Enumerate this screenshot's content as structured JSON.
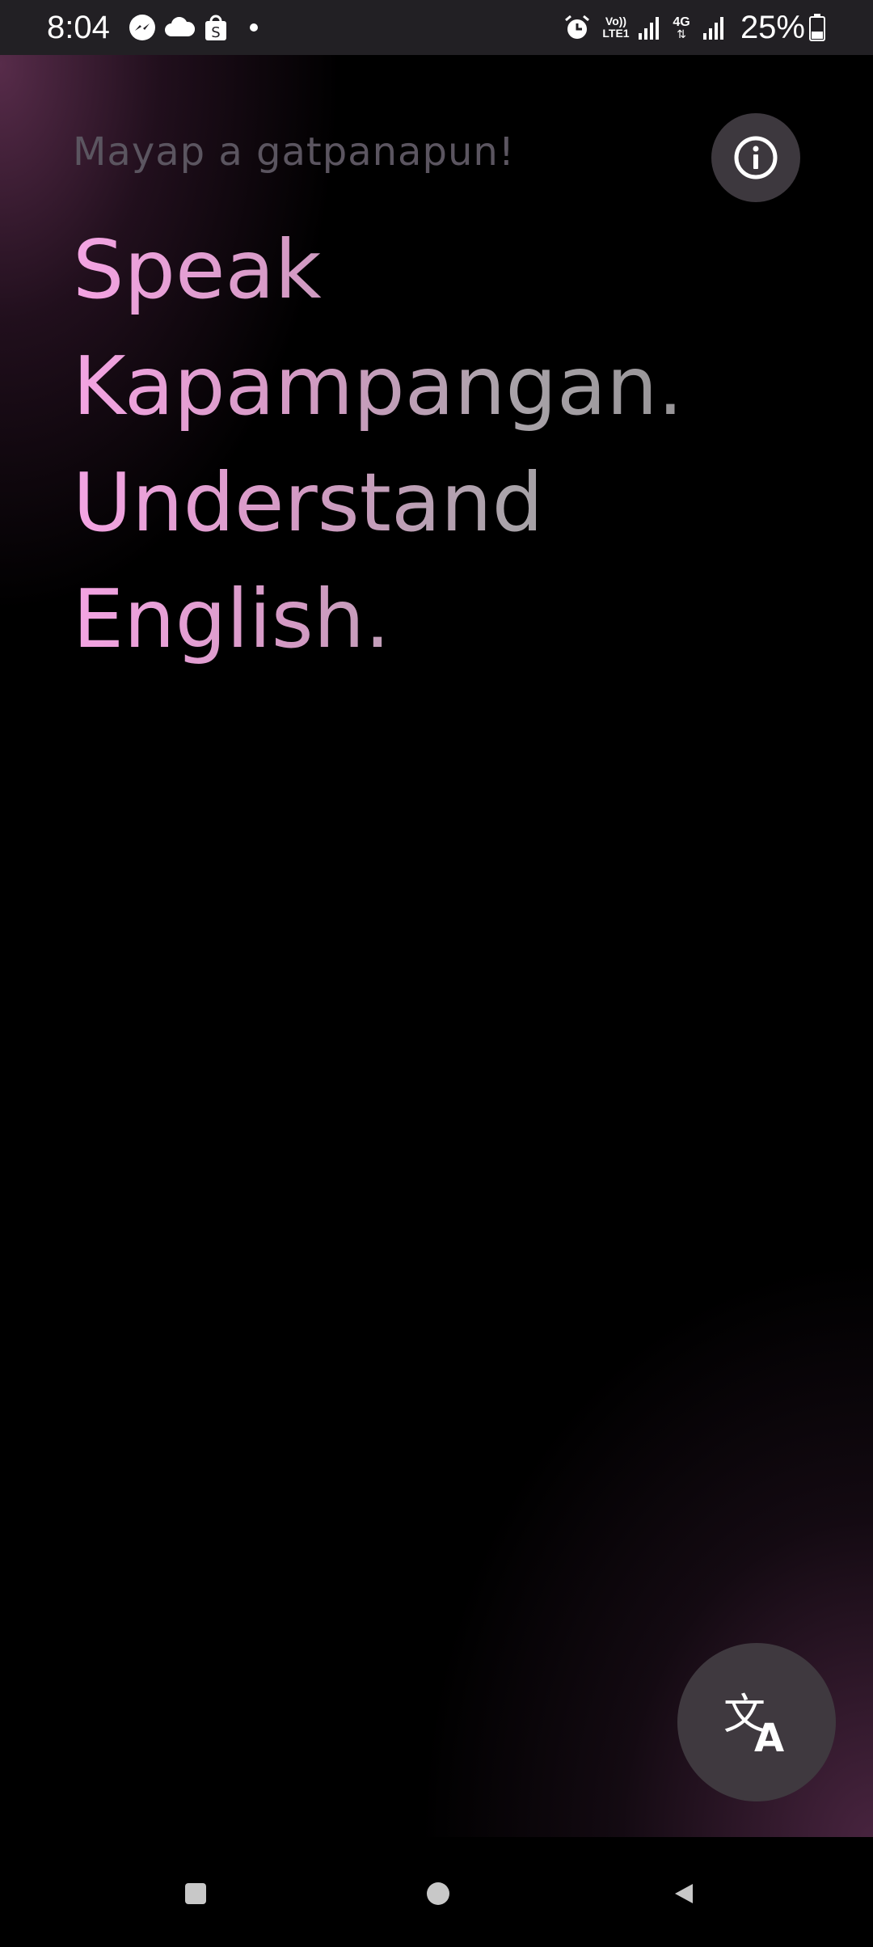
{
  "status_bar": {
    "time": "8:04",
    "left_icons": [
      "messenger-icon",
      "cloud-icon",
      "shopee-icon",
      "dot-icon"
    ],
    "right_icons": [
      "alarm-icon",
      "volte-icon",
      "signal-icon",
      "4g-icon",
      "signal-icon",
      "battery-icon"
    ],
    "volte_label": "Vo)) LTE1",
    "network_label": "4G",
    "battery": "25%"
  },
  "main": {
    "greeting": "Mayap a gatpanapun!",
    "headline": [
      "Speak",
      "Kapampangan.",
      "Understand",
      "English."
    ],
    "info_button_icon": "info-icon",
    "translate_button_icon": "translate-icon"
  },
  "nav_bar": {
    "buttons": [
      "recents-icon",
      "home-icon",
      "back-icon"
    ]
  },
  "colors": {
    "accent_pink": "#f4a4e3",
    "gray_text": "#8a8a8a",
    "button_bg": "#3d383e",
    "background": "#000000"
  }
}
